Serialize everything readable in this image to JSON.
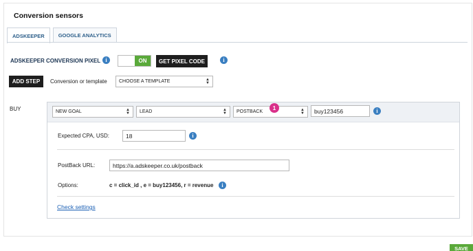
{
  "panel": {
    "title": "Conversion sensors"
  },
  "tabs": [
    {
      "label": "ADSKEEPER",
      "active": true
    },
    {
      "label": "GOOGLE ANALYTICS",
      "active": false
    }
  ],
  "pixel": {
    "label": "ADSKEEPER CONVERSION PIXEL",
    "toggle_state": "ON",
    "get_code_label": "GET PIXEL CODE"
  },
  "step": {
    "add_label": "ADD STEP",
    "template_label": "Conversion or template",
    "template_value": "CHOOSE A TEMPLATE"
  },
  "goal": {
    "row_label": "BUY",
    "goal_select": "NEW GOAL",
    "type_select": "LEAD",
    "method_select": "POSTBACK",
    "name_value": "buy123456",
    "badge": "1",
    "cpa_label": "Expected CPA, USD:",
    "cpa_value": "18",
    "postback_label": "PostBack URL:",
    "postback_value": "https://a.adskeeper.co.uk/postback",
    "options_label": "Options:",
    "options_value": "c = click_id , e = buy123456, r = revenue",
    "check_link": "Check settings"
  },
  "footer": {
    "save_label": "SAVE"
  },
  "colors": {
    "accent_green": "#5aa93a",
    "info_blue": "#3a7fc1",
    "badge_pink": "#d9308a",
    "dark_button": "#1e1e1e"
  },
  "icons": [
    "info-icon",
    "select-arrows-icon"
  ]
}
